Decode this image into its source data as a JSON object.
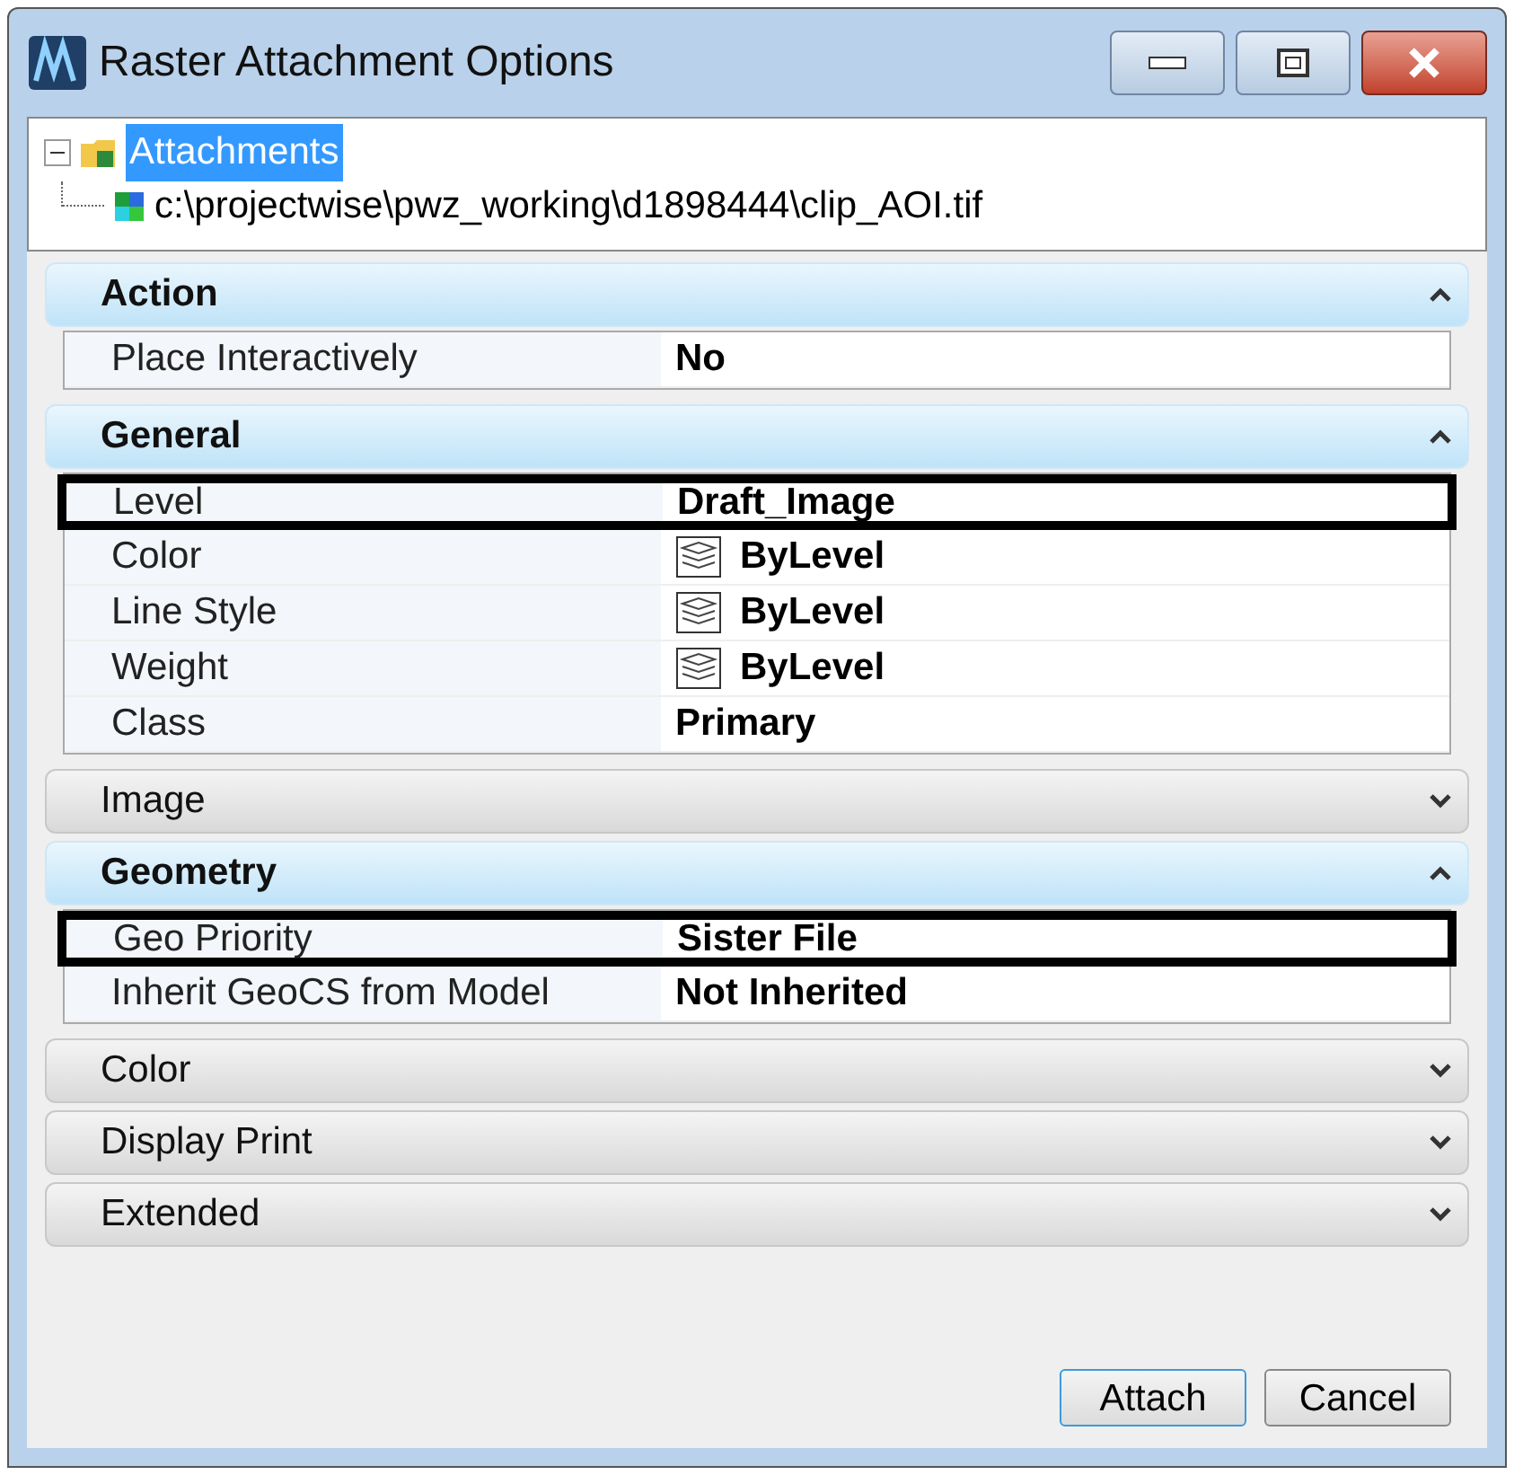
{
  "window": {
    "title": "Raster Attachment Options"
  },
  "tree": [
    {
      "label": "Attachments",
      "selected": true,
      "expanded": true,
      "children": [
        {
          "label": "c:\\projectwise\\pwz_working\\d1898444\\clip_AOI.tif",
          "selected": false
        }
      ]
    }
  ],
  "sections": [
    {
      "title": "Action",
      "expanded": true,
      "rows": [
        {
          "name": "Place Interactively",
          "value": "No",
          "kind": "text",
          "highlighted": false
        }
      ]
    },
    {
      "title": "General",
      "expanded": true,
      "rows": [
        {
          "name": "Level",
          "value": "Draft_Image",
          "kind": "text",
          "highlighted": true
        },
        {
          "name": "Color",
          "value": "ByLevel",
          "kind": "bylevel",
          "highlighted": false
        },
        {
          "name": "Line Style",
          "value": "ByLevel",
          "kind": "bylevel",
          "highlighted": false
        },
        {
          "name": "Weight",
          "value": "ByLevel",
          "kind": "bylevel",
          "highlighted": false
        },
        {
          "name": "Class",
          "value": "Primary",
          "kind": "text",
          "highlighted": false
        }
      ]
    },
    {
      "title": "Image",
      "expanded": false
    },
    {
      "title": "Geometry",
      "expanded": true,
      "rows": [
        {
          "name": "Geo Priority",
          "value": "Sister File",
          "kind": "text",
          "highlighted": true
        },
        {
          "name": "Inherit GeoCS from Model",
          "value": "Not Inherited",
          "kind": "text",
          "highlighted": false
        }
      ]
    },
    {
      "title": "Color",
      "expanded": false
    },
    {
      "title": "Display Print",
      "expanded": false
    },
    {
      "title": "Extended",
      "expanded": false
    }
  ],
  "buttons": [
    "Attach",
    "Cancel"
  ]
}
